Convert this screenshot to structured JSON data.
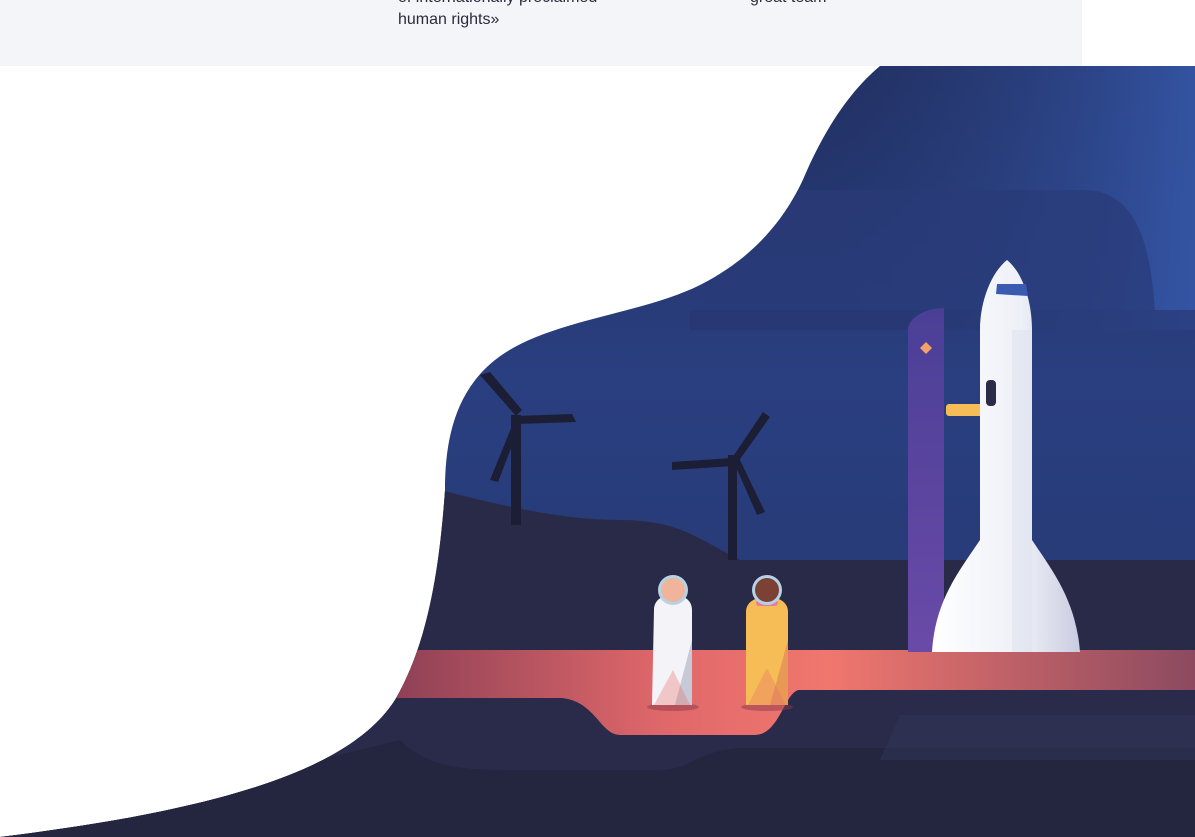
{
  "quote": {
    "line1": "of internationally proclaimed",
    "line2": "human rights»"
  },
  "team": {
    "text": "great team"
  },
  "illustration": {
    "subject": "rocket launch scene with two astronauts and wind turbines",
    "icons": [
      "rocket-icon",
      "wind-turbine-icon",
      "astronaut-icon"
    ]
  },
  "colors": {
    "sky_dark": "#1f2b55",
    "sky_mid": "#2c4487",
    "ground_dark": "#262742",
    "runway": "#e8706a",
    "tower": "#5b44a0",
    "rocket": "#eef0f6",
    "astronaut_yellow": "#f6bd56",
    "panel_bg": "#f4f5f8"
  }
}
